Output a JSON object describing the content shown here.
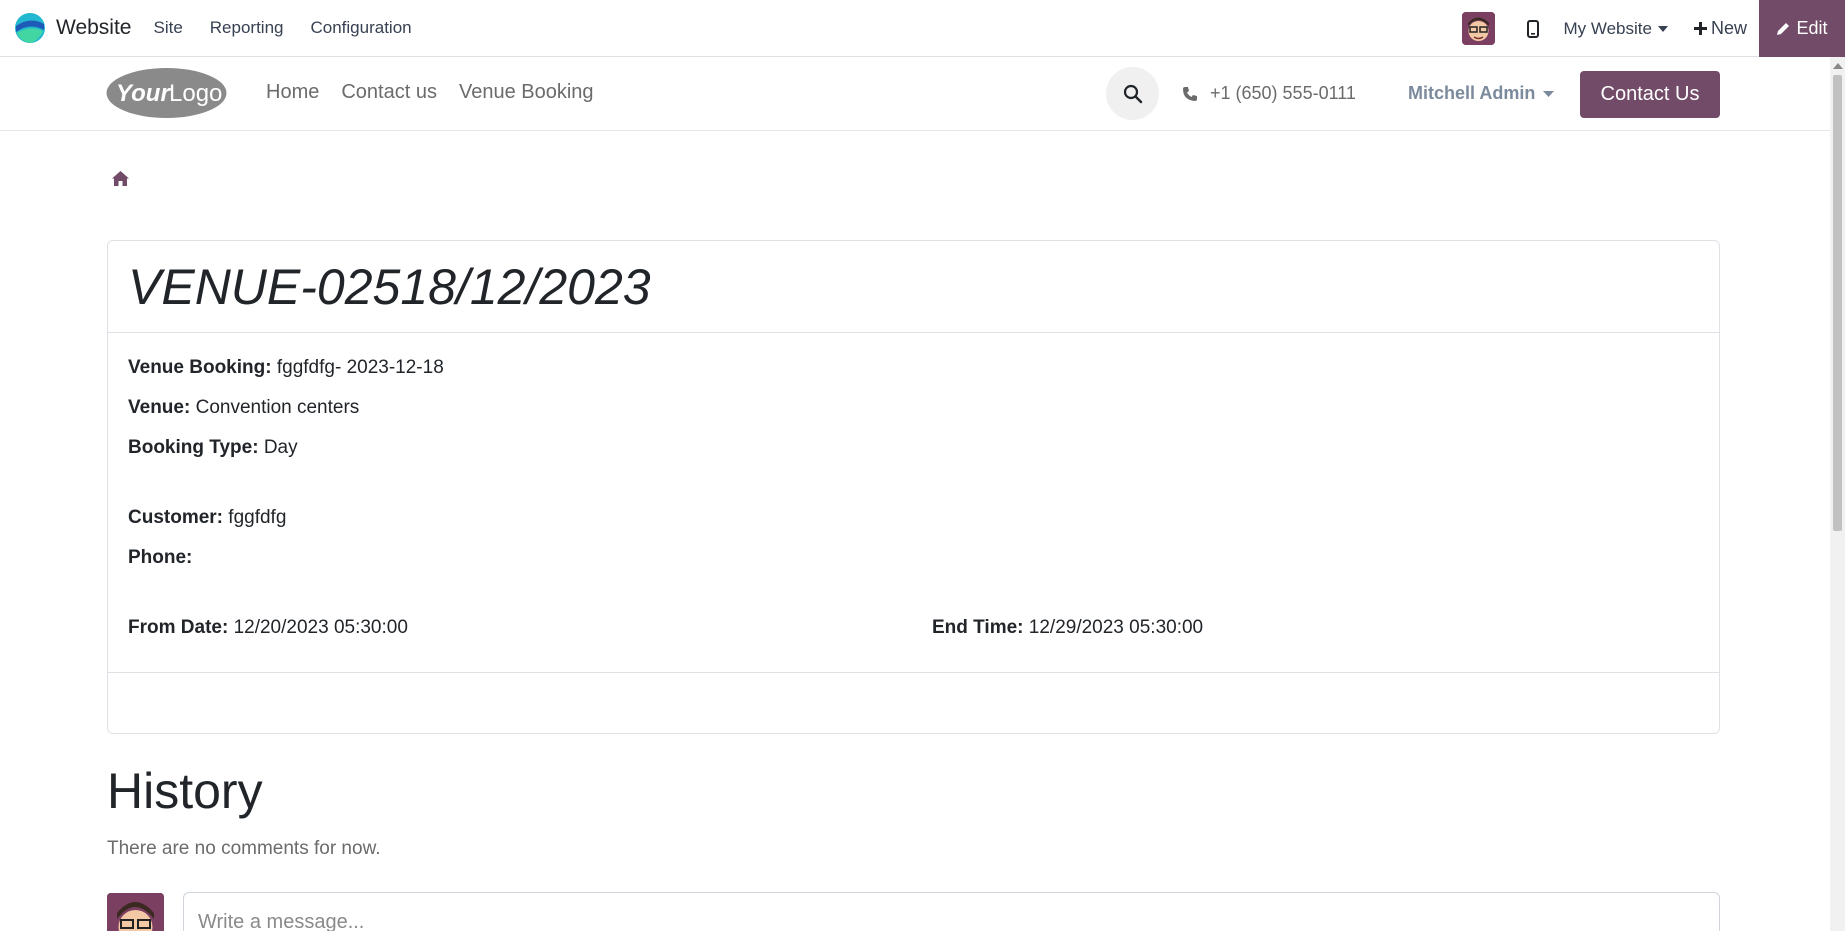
{
  "adminbar": {
    "app_name": "Website",
    "menu": [
      "Site",
      "Reporting",
      "Configuration"
    ],
    "site_switch": "My Website",
    "new_label": "New",
    "edit_label": "Edit"
  },
  "header": {
    "nav": [
      "Home",
      "Contact us",
      "Venue Booking"
    ],
    "phone": "+1 (650) 555-0111",
    "user": "Mitchell Admin",
    "contact_button": "Contact Us"
  },
  "record": {
    "title": "VENUE-02518/12/2023",
    "fields": {
      "venue_booking": {
        "label": "Venue Booking:",
        "value": "fggfdfg- 2023-12-18"
      },
      "venue": {
        "label": "Venue:",
        "value": "Convention centers"
      },
      "booking_type": {
        "label": "Booking Type:",
        "value": "Day"
      },
      "customer": {
        "label": "Customer:",
        "value": "fggfdfg"
      },
      "phone": {
        "label": "Phone:",
        "value": ""
      },
      "from_date": {
        "label": "From Date:",
        "value": "12/20/2023 05:30:00"
      },
      "end_time": {
        "label": "End Time:",
        "value": "12/29/2023 05:30:00"
      }
    }
  },
  "history": {
    "title": "History",
    "empty_text": "There are no comments for now.",
    "message_placeholder": "Write a message..."
  },
  "colors": {
    "brand": "#714b67",
    "muted_text": "#6b6b6b"
  },
  "icons": [
    "app-logo-icon",
    "mobile-icon",
    "caret-down-icon",
    "plus-icon",
    "pencil-icon",
    "search-icon",
    "phone-icon",
    "home-icon"
  ]
}
